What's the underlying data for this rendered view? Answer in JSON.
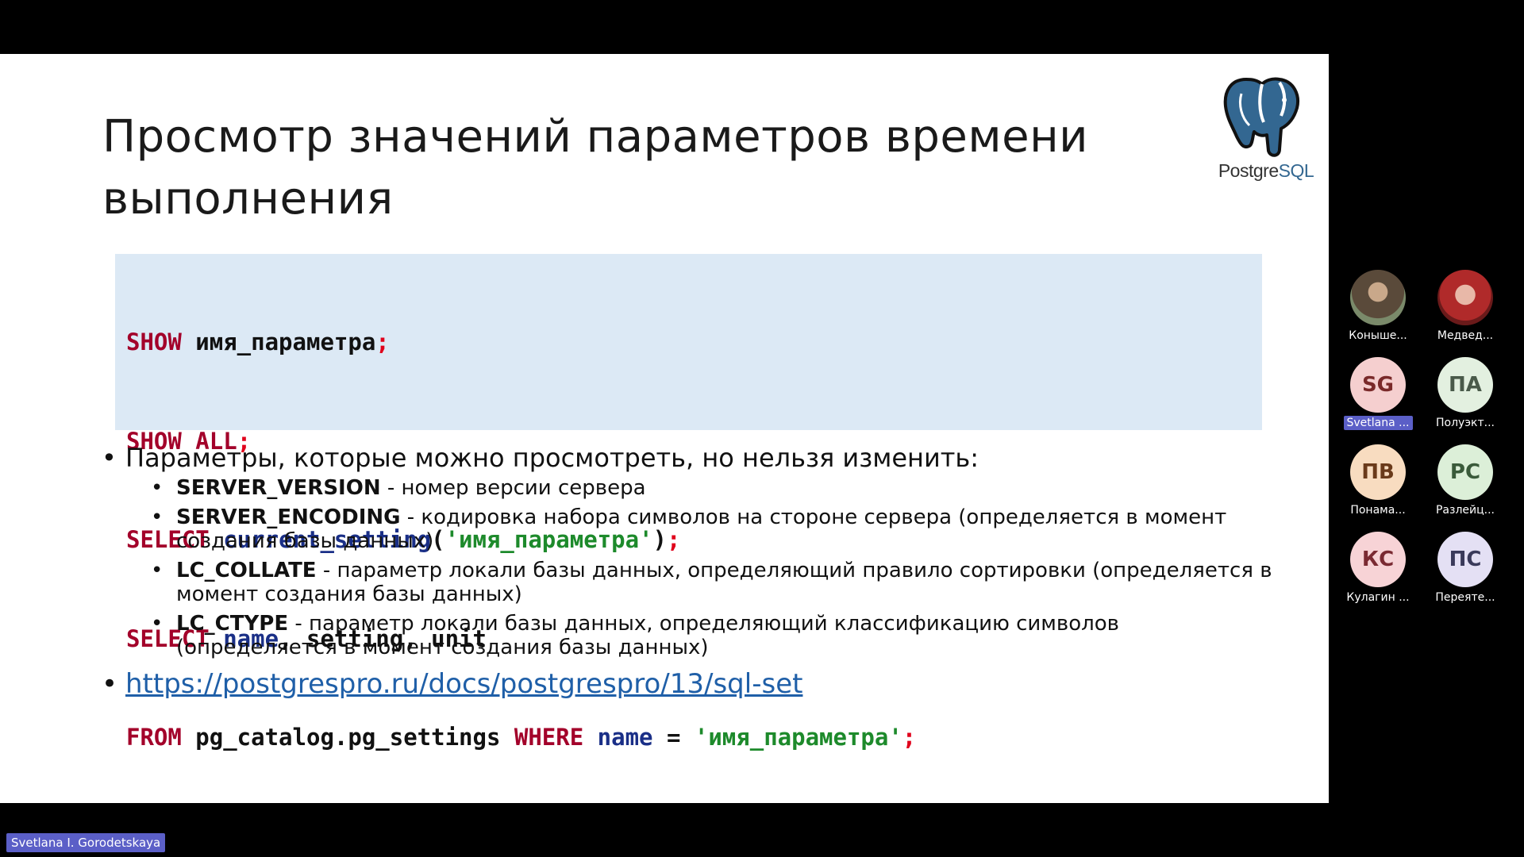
{
  "slide": {
    "title": "Просмотр значений параметров времени выполнения",
    "logo_text_main": "Postgre",
    "logo_text_sql": "SQL",
    "code": {
      "l1_kw": "SHOW",
      "l1_txt": " имя_параметра",
      "l1_p": ";",
      "l2_kw": "SHOW ALL",
      "l2_p": ";",
      "l3_kw": "SELECT",
      "l3_fn": " current_setting",
      "l3_p1": "(",
      "l3_str": "'имя_параметра'",
      "l3_p2": ")",
      "l3_p3": ";",
      "l4_kw": "SELECT",
      "l4_fn": " name",
      "l4_txt": ", setting, unit",
      "l5_kw": "FROM",
      "l5_txt": " pg_catalog.pg_settings ",
      "l5_kw2": "WHERE",
      "l5_fn": " name",
      "l5_txt2": " = ",
      "l5_str": "'имя_параметра'",
      "l5_p": ";"
    },
    "bullet_main": "Параметры, которые можно просмотреть, но нельзя изменить:",
    "sub_items": [
      {
        "term": "SERVER_VERSION",
        "desc": "  - номер версии сервера"
      },
      {
        "term": "SERVER_ENCODING",
        "desc": " - кодировка набора символов на стороне сервера (определяется в момент создания базы данных)"
      },
      {
        "term": "LC_COLLATE",
        "desc": " - параметр локали базы данных, определяющий правило сортировки (определяется в момент создания базы данных)"
      },
      {
        "term": "LC_CTYPE",
        "desc": " - параметр локали базы данных, определяющий классификацию символов (определяется в момент создания базы данных)"
      }
    ],
    "link": "https://postgrespro.ru/docs/postgrespro/13/sql-set"
  },
  "participants": [
    {
      "initials": "",
      "name": "Коныше...",
      "style": "photo1",
      "active": false
    },
    {
      "initials": "",
      "name": "Медвед...",
      "style": "photo2",
      "active": false
    },
    {
      "initials": "SG",
      "name": "Svetlana ...",
      "style": "pink",
      "active": true
    },
    {
      "initials": "ПА",
      "name": "Полуэкт...",
      "style": "green",
      "active": false
    },
    {
      "initials": "ПВ",
      "name": "Понама...",
      "style": "peach",
      "active": false
    },
    {
      "initials": "РС",
      "name": "Разлейц...",
      "style": "lightgreen",
      "active": false
    },
    {
      "initials": "КС",
      "name": "Кулагин ...",
      "style": "rose",
      "active": false
    },
    {
      "initials": "ПС",
      "name": "Переяте...",
      "style": "lavender",
      "active": false
    }
  ],
  "speaker": "Svetlana I. Gorodetskaya",
  "colors": {
    "keyword": "#a3002a",
    "function": "#1a2f87",
    "string": "#1d8a2b",
    "code_bg": "#dce9f5",
    "active_name": "#5b5fc7"
  }
}
